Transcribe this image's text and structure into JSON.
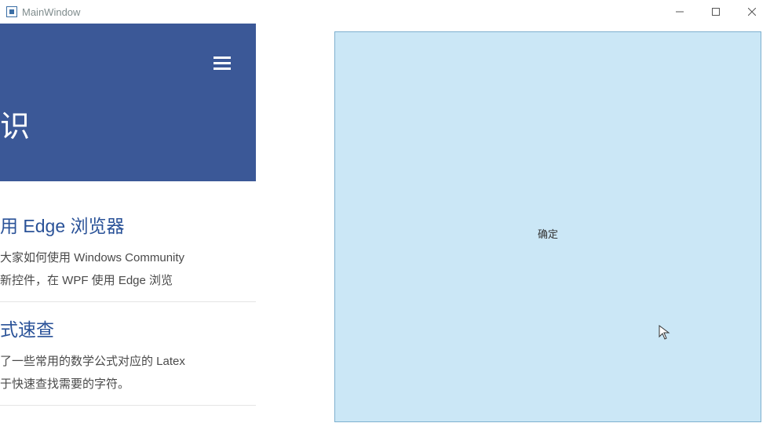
{
  "window": {
    "title": "MainWindow"
  },
  "banner": {
    "partial_text": "识"
  },
  "articles": [
    {
      "title": "用 Edge 浏览器",
      "body_line1": "大家如何使用 Windows Community",
      "body_line2": "新控件，在 WPF 使用 Edge 浏览"
    },
    {
      "title": "式速查",
      "body_line1": "了一些常用的数学公式对应的 Latex",
      "body_line2": "于快速查找需要的字符。"
    }
  ],
  "right_panel": {
    "button_label": "确定"
  }
}
